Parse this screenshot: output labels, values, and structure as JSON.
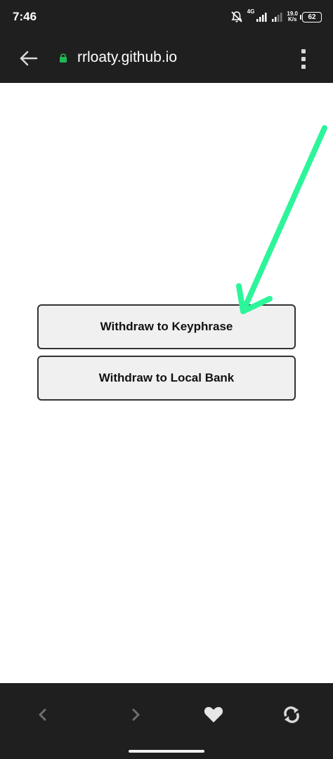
{
  "status_bar": {
    "time": "7:46",
    "network_type": "4G",
    "net_speed_value": "19.0",
    "net_speed_unit": "K/s",
    "battery": "62",
    "icons": [
      "bell-off-icon",
      "signal-icon",
      "signal-icon",
      "battery-icon"
    ]
  },
  "browser": {
    "url": "rrloaty.github.io",
    "secure": true,
    "colors": {
      "lock": "#1db954",
      "bar": "#1f1f1f"
    }
  },
  "page": {
    "buttons": [
      {
        "label": "Withdraw to Keyphrase"
      },
      {
        "label": "Withdraw to Local Bank"
      }
    ],
    "annotation": {
      "type": "arrow",
      "color": "#2cf59a",
      "points_to": "Withdraw to Keyphrase"
    }
  },
  "bottom_nav": {
    "icons": [
      "chevron-left-icon",
      "chevron-right-icon",
      "heart-icon",
      "refresh-icon"
    ]
  }
}
